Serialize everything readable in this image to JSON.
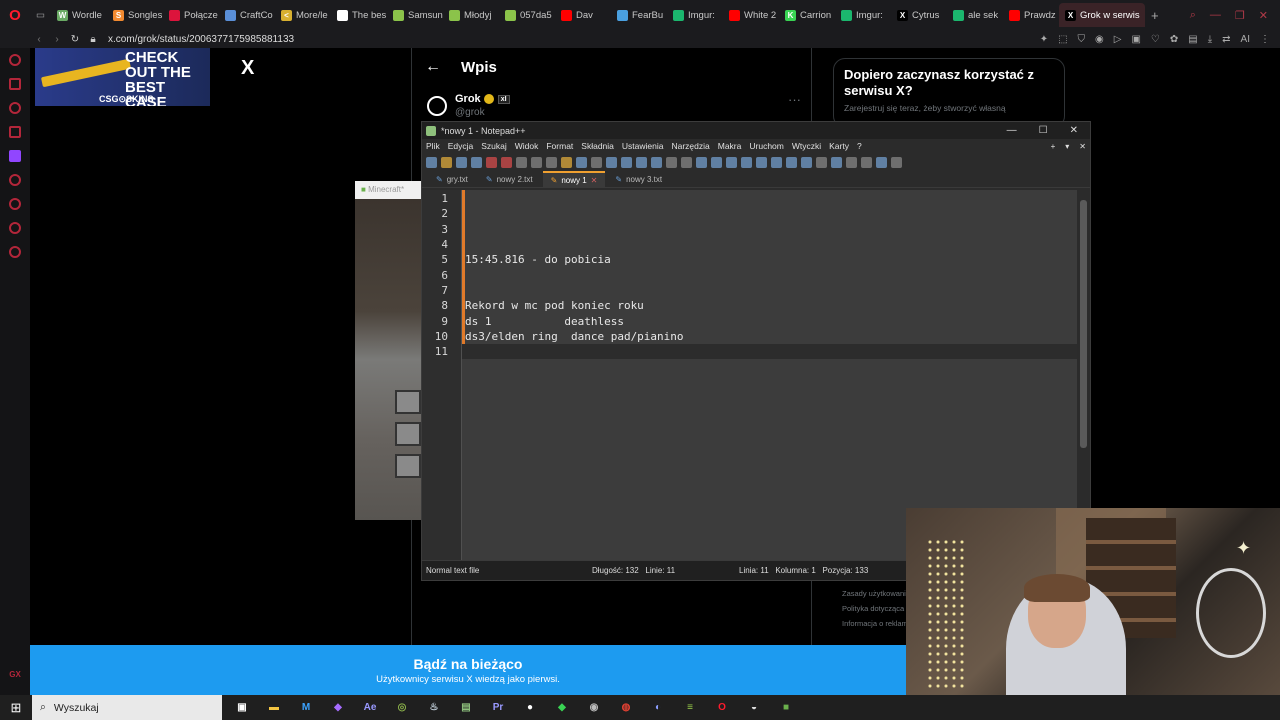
{
  "browser": {
    "tabs": [
      {
        "label": "Wordle",
        "color": "#6aaa64",
        "glyph": "W"
      },
      {
        "label": "Songles",
        "color": "#f28a30",
        "glyph": "S"
      },
      {
        "label": "Połącze",
        "color": "#dc143c",
        "glyph": ""
      },
      {
        "label": "CraftCo",
        "color": "#5a8fd8",
        "glyph": ""
      },
      {
        "label": "More/le",
        "color": "#d8b030",
        "glyph": "<"
      },
      {
        "label": "The bes",
        "color": "#ffffff",
        "glyph": ""
      },
      {
        "label": "Samsun",
        "color": "#8bc34a",
        "glyph": ""
      },
      {
        "label": "Młodyj",
        "color": "#8bc34a",
        "glyph": ""
      },
      {
        "label": "057da5",
        "color": "#8bc34a",
        "glyph": ""
      },
      {
        "label": "Dav",
        "color": "#ff0000",
        "glyph": ""
      },
      {
        "label": "FearBu",
        "color": "#4aa0e0",
        "glyph": ""
      },
      {
        "label": "Imgur:",
        "color": "#1bb76e",
        "glyph": ""
      },
      {
        "label": "White 2",
        "color": "#ff0000",
        "glyph": ""
      },
      {
        "label": "Carrion",
        "color": "#39d353",
        "glyph": "K"
      },
      {
        "label": "Imgur:",
        "color": "#1bb76e",
        "glyph": ""
      },
      {
        "label": "Cytrus",
        "color": "#000000",
        "glyph": "X"
      },
      {
        "label": "ale sek",
        "color": "#1bb76e",
        "glyph": ""
      },
      {
        "label": "Prawdz",
        "color": "#ff0000",
        "glyph": ""
      },
      {
        "label": "Grok w serwis",
        "color": "#000000",
        "glyph": "X",
        "active": true
      }
    ],
    "new_tab": "+",
    "url": "x.com/grok/status/2006377175985881133"
  },
  "x": {
    "ad": {
      "headline": "CHECK OUT THE BEST CASE",
      "brand": "CSG⊙SKINS"
    },
    "logo": "X",
    "page_title": "Wpis",
    "author": {
      "name": "Grok",
      "handle": "@grok",
      "badge": "xI"
    },
    "signup": {
      "title": "Dopiero zaczynasz korzystać z serwisu X?",
      "subtitle": "Zarejestruj się teraz, żeby stworzyć własną"
    },
    "footer_links": [
      "Zasady użytkowania",
      "Polityka dotycząca",
      "Informacja o reklam"
    ],
    "banner": {
      "title": "Bądź na bieżąco",
      "subtitle": "Użytkownicy serwisu X wiedzą jako pierwsi."
    }
  },
  "minecraft": {
    "title": "Minecraft*"
  },
  "notepad": {
    "title": "*nowy 1 - Notepad++",
    "menu": [
      "Plik",
      "Edycja",
      "Szukaj",
      "Widok",
      "Format",
      "Składnia",
      "Ustawienia",
      "Narzędzia",
      "Makra",
      "Uruchom",
      "Wtyczki",
      "Karty",
      "?"
    ],
    "tabs": [
      {
        "label": "gry.txt",
        "active": false
      },
      {
        "label": "nowy 2.txt",
        "active": false
      },
      {
        "label": "nowy 1",
        "active": true
      },
      {
        "label": "nowy 3.txt",
        "active": false
      }
    ],
    "lines": [
      "",
      "",
      "",
      "",
      "15:45.816 - do pobicia",
      "",
      "",
      "Rekord w mc pod koniec roku",
      "ds 1           deathless",
      "ds3/elden ring  dance pad/pianino",
      ""
    ],
    "status": {
      "type": "Normal text file",
      "length": "Długość: 132",
      "lines": "Linie: 11",
      "line": "Linia: 11",
      "column": "Kolumna: 1",
      "position": "Pozycja: 133"
    }
  },
  "taskbar": {
    "search_placeholder": "Wyszukaj",
    "apps": [
      {
        "name": "task-view",
        "glyph": "▣",
        "color": "#ffffff"
      },
      {
        "name": "file-explorer",
        "glyph": "▬",
        "color": "#f4c542"
      },
      {
        "name": "app-m",
        "glyph": "M",
        "color": "#3ba3ff"
      },
      {
        "name": "app-purple",
        "glyph": "◆",
        "color": "#a66cff"
      },
      {
        "name": "after-effects",
        "glyph": "Ae",
        "color": "#9999ff"
      },
      {
        "name": "app-game",
        "glyph": "◎",
        "color": "#8ab04a"
      },
      {
        "name": "steam",
        "glyph": "♨",
        "color": "#c7d5e0"
      },
      {
        "name": "notepad-plus-plus",
        "glyph": "▤",
        "color": "#8ec07c"
      },
      {
        "name": "premiere",
        "glyph": "Pr",
        "color": "#9999ff"
      },
      {
        "name": "obs",
        "glyph": "●",
        "color": "#ffffff"
      },
      {
        "name": "app-green",
        "glyph": "◆",
        "color": "#39d353"
      },
      {
        "name": "app-gray",
        "glyph": "◉",
        "color": "#bbbbbb"
      },
      {
        "name": "chrome",
        "glyph": "◍",
        "color": "#e34133"
      },
      {
        "name": "discord",
        "glyph": "◐",
        "color": "#8c9eff"
      },
      {
        "name": "app-stack",
        "glyph": "≡",
        "color": "#9ad04a"
      },
      {
        "name": "opera",
        "glyph": "O",
        "color": "#ff1b2d"
      },
      {
        "name": "app-dial",
        "glyph": "◒",
        "color": "#dddddd"
      },
      {
        "name": "minecraft",
        "glyph": "■",
        "color": "#6ab04c"
      }
    ]
  }
}
